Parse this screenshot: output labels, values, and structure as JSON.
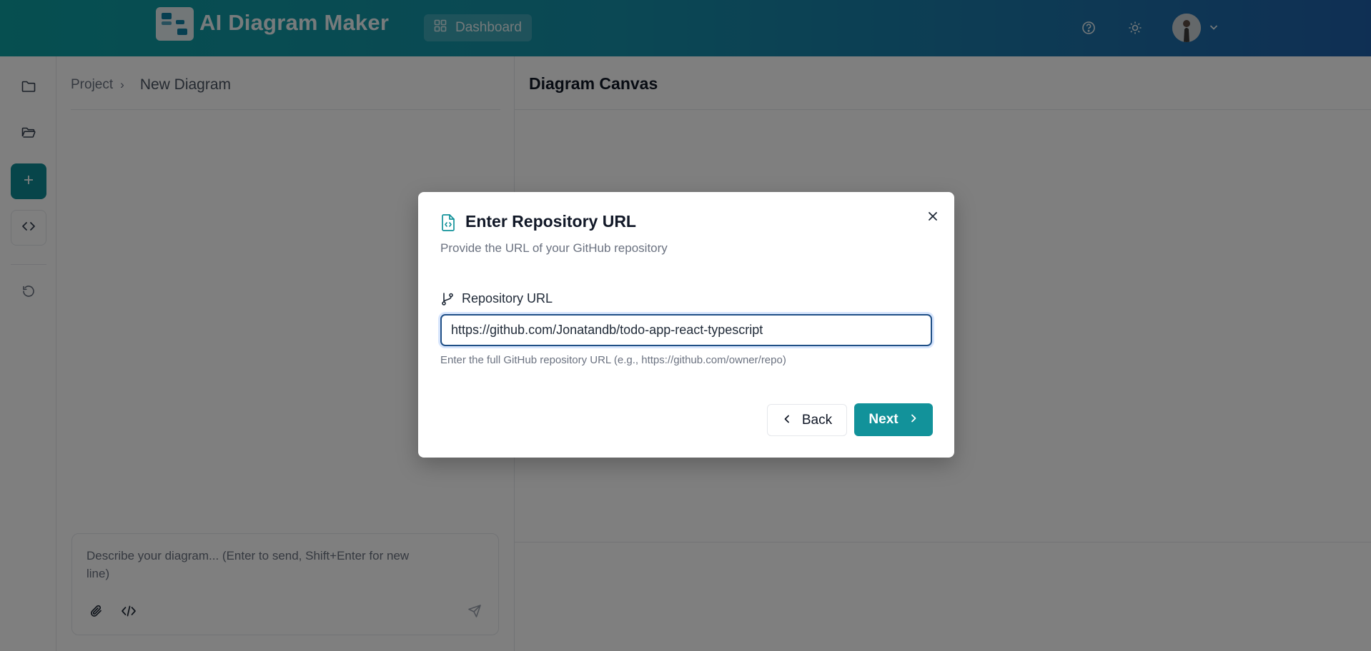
{
  "header": {
    "brand": "AI Diagram Maker",
    "dashboard_label": "Dashboard",
    "help_icon": "help-circle-icon",
    "theme_icon": "sun-icon"
  },
  "sidebar": {
    "items": [
      {
        "icon": "folder-icon"
      },
      {
        "icon": "folder-open-icon"
      },
      {
        "icon": "plus-icon",
        "active": true
      },
      {
        "icon": "code-icon"
      },
      {
        "icon": "history-icon"
      }
    ]
  },
  "breadcrumb": {
    "project": "Project",
    "separator": "›",
    "current": "New Diagram"
  },
  "chat": {
    "placeholder": "Describe your diagram... (Enter to send, Shift+Enter for new line)"
  },
  "canvas": {
    "title": "Diagram Canvas"
  },
  "modal": {
    "title": "Enter Repository URL",
    "subtitle": "Provide the URL of your GitHub repository",
    "field_label": "Repository URL",
    "field_value": "https://github.com/Jonatandb/todo-app-react-typescript",
    "help_text": "Enter the full GitHub repository URL (e.g., https://github.com/owner/repo)",
    "back_label": "Back",
    "next_label": "Next"
  },
  "colors": {
    "primary": "#12929a",
    "header_start": "#0c9ea1",
    "header_end": "#1f5fa8",
    "input_border": "#1f4f86"
  }
}
